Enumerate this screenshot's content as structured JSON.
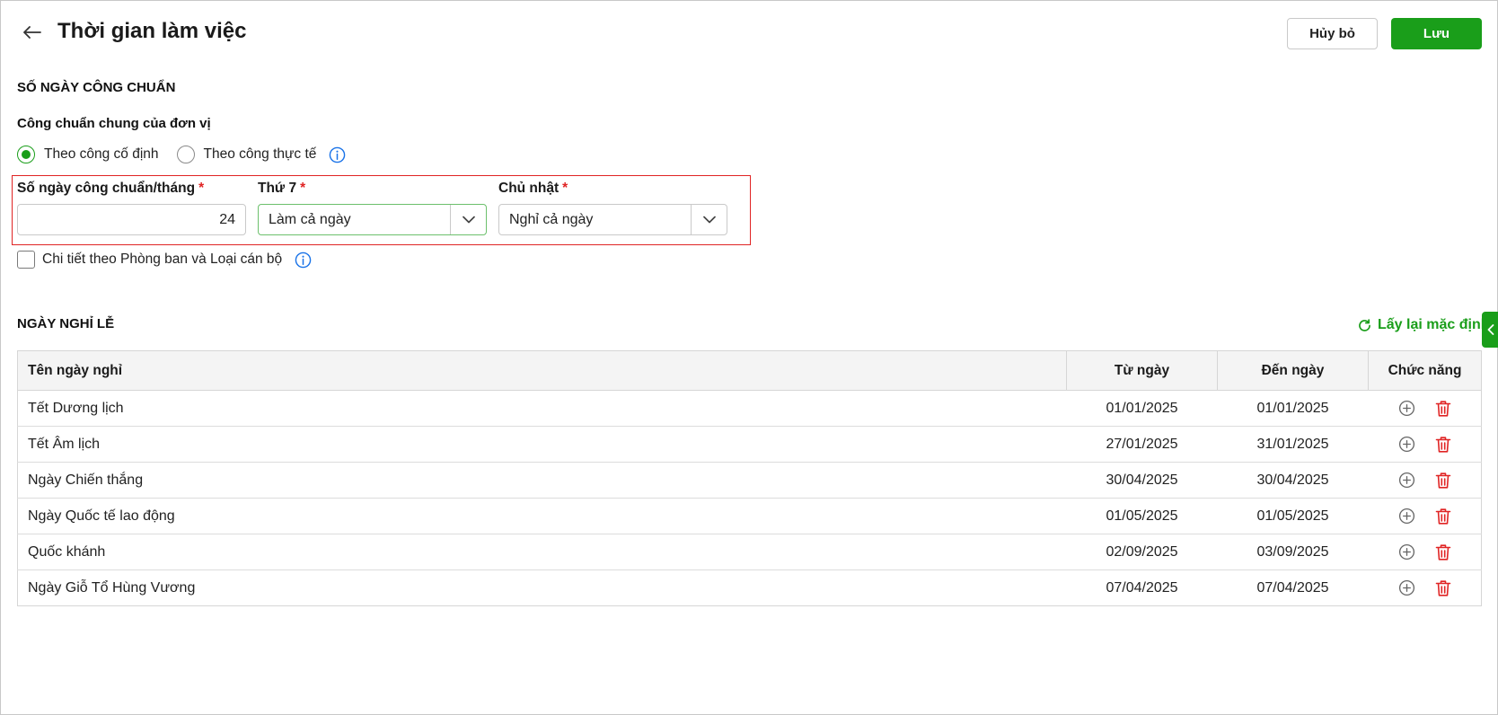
{
  "header": {
    "title": "Thời gian làm việc",
    "cancel_label": "Hủy bỏ",
    "save_label": "Lưu"
  },
  "standard_days": {
    "section_title": "SỐ NGÀY CÔNG CHUẨN",
    "subtitle": "Công chuẩn chung của đơn vị",
    "radio_options": [
      {
        "label": "Theo công cố định",
        "selected": true
      },
      {
        "label": "Theo công thực tế",
        "selected": false
      }
    ],
    "fields": {
      "days_label": "Số ngày công chuẩn/tháng",
      "days_value": "24",
      "saturday_label": "Thứ 7",
      "saturday_value": "Làm cả ngày",
      "sunday_label": "Chủ nhật",
      "sunday_value": "Nghỉ cả ngày",
      "required_mark": "*"
    },
    "detail_checkbox_label": "Chi tiết theo Phòng ban và Loại cán bộ",
    "detail_checked": false
  },
  "holidays": {
    "section_title": "NGÀY NGHỈ LỄ",
    "reset_label": "Lấy lại mặc định",
    "columns": [
      "Tên ngày nghỉ",
      "Từ ngày",
      "Đến ngày",
      "Chức năng"
    ],
    "rows": [
      {
        "name": "Tết Dương lịch",
        "from": "01/01/2025",
        "to": "01/01/2025"
      },
      {
        "name": "Tết Âm lịch",
        "from": "27/01/2025",
        "to": "31/01/2025"
      },
      {
        "name": "Ngày Chiến thắng",
        "from": "30/04/2025",
        "to": "30/04/2025"
      },
      {
        "name": "Ngày Quốc tế lao động",
        "from": "01/05/2025",
        "to": "01/05/2025"
      },
      {
        "name": "Quốc khánh",
        "from": "02/09/2025",
        "to": "03/09/2025"
      },
      {
        "name": "Ngày Giỗ Tổ Hùng Vương",
        "from": "07/04/2025",
        "to": "07/04/2025"
      }
    ]
  },
  "colors": {
    "accent": "#1a9e1a",
    "danger": "#e02424",
    "info": "#1a73e8"
  },
  "icons": {
    "back": "arrow-left-icon",
    "info": "info-circle-icon",
    "refresh": "refresh-icon",
    "chevron": "chevron-down-icon",
    "add": "plus-circle-icon",
    "delete": "trash-icon",
    "side_toggle": "chevron-left-icon"
  }
}
